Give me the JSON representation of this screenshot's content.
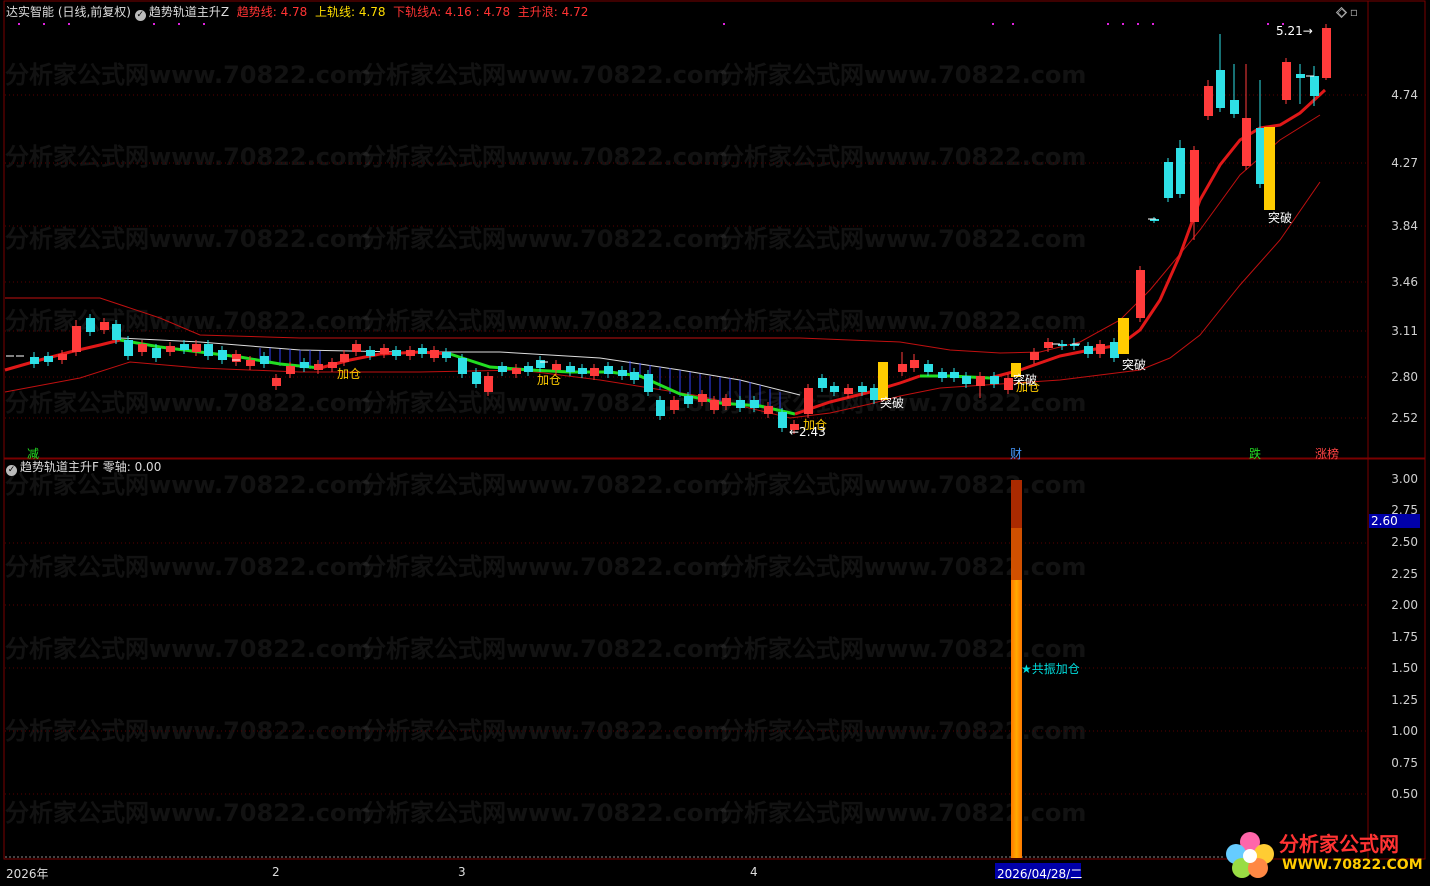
{
  "header": {
    "title": "达实智能 (日线,前复权)",
    "indicator": "趋势轨道主升Z",
    "trend_label": "趋势线:",
    "trend_value": "4.78",
    "upper_label": "上轨线:",
    "upper_value": "4.78",
    "lower_label": "下轨线A:",
    "lower_value": "4.16 : 4.78",
    "main_label": "主升浪:",
    "main_value": "4.72"
  },
  "sub_header": {
    "indicator": "趋势轨道主升F",
    "zero_label": "零轴:",
    "zero_value": "0.00"
  },
  "colors": {
    "up": "#ff3b3b",
    "down": "#2ee0e6",
    "trend": "#e01818",
    "green": "#22dd22",
    "gold": "#ffcc00",
    "axis": "#8b0000"
  },
  "main_axis": {
    "ticks": [
      "4.74",
      "4.27",
      "3.84",
      "3.46",
      "3.11",
      "2.80",
      "2.52"
    ]
  },
  "sub_axis": {
    "ticks": [
      "3.00",
      "2.75",
      "2.50",
      "2.25",
      "2.00",
      "1.75",
      "1.50",
      "1.25",
      "1.00",
      "0.75",
      "0.50"
    ],
    "current": "2.60"
  },
  "x_axis": {
    "labels": [
      "2026年",
      "2",
      "3",
      "4"
    ],
    "cursor_date": "2026/04/28/二"
  },
  "annotations": {
    "jiacang": "加仓",
    "tupo": "突破",
    "low_price": "←2.43",
    "high_price": "5.21→",
    "resonance": "★共振加仓",
    "jian": "减",
    "cai": "财",
    "die": "跌",
    "zhang": "涨榜"
  },
  "watermark": "分析家公式网www.70822.com",
  "logo": {
    "title": "分析家公式网",
    "url": "WWW.70822.COM"
  },
  "bar_value": 3.0
}
